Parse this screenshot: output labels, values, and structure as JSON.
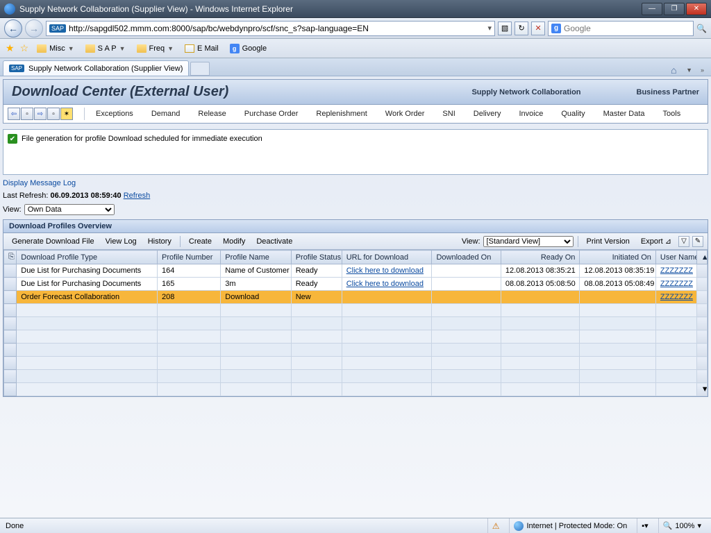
{
  "window": {
    "title": "Supply Network Collaboration (Supplier View) - Windows Internet Explorer"
  },
  "nav": {
    "url": "http://sapgdl502.mmm.com:8000/sap/bc/webdynpro/scf/snc_s?sap-language=EN",
    "search_placeholder": "Google"
  },
  "favorites": {
    "misc": "Misc",
    "sap": "S A P",
    "freq": "Freq",
    "email": "E Mail",
    "google": "Google"
  },
  "tab": {
    "label": "Supply Network Collaboration (Supplier View)"
  },
  "page": {
    "title": "Download Center (External User)",
    "header_right1": "Supply Network Collaboration",
    "header_right2": "Business Partner"
  },
  "menu": [
    "Exceptions",
    "Demand",
    "Release",
    "Purchase Order",
    "Replenishment",
    "Work Order",
    "SNI",
    "Delivery",
    "Invoice",
    "Quality",
    "Master Data",
    "Tools"
  ],
  "message": "File generation for profile Download scheduled for immediate execution",
  "display_log": "Display Message Log",
  "last_refresh_label": "Last Refresh:",
  "last_refresh_time": "06.09.2013 08:59:40",
  "refresh": "Refresh",
  "view_label": "View:",
  "view_value": "Own Data",
  "panel_title": "Download Profiles Overview",
  "toolbar": {
    "generate": "Generate Download File",
    "viewlog": "View Log",
    "history": "History",
    "create": "Create",
    "modify": "Modify",
    "deactivate": "Deactivate",
    "view_label": "View:",
    "view_value": "[Standard View]",
    "print": "Print Version",
    "export": "Export"
  },
  "columns": [
    "Download Profile Type",
    "Profile Number",
    "Profile Name",
    "Profile Status",
    "URL for Download",
    "Downloaded On",
    "Ready On",
    "Initiated On",
    "User Name"
  ],
  "rows": [
    {
      "type": "Due List for Purchasing Documents",
      "num": "164",
      "name": "Name of Customer",
      "status": "Ready",
      "url": "Click here to download",
      "dl": "",
      "ready": "12.08.2013 08:35:21",
      "init": "12.08.2013 08:35:19",
      "user": "ZZZZZZZ",
      "sel": false
    },
    {
      "type": "Due List for Purchasing Documents",
      "num": "165",
      "name": "3m",
      "status": "Ready",
      "url": "Click here to download",
      "dl": "",
      "ready": "08.08.2013 05:08:50",
      "init": "08.08.2013 05:08:49",
      "user": "ZZZZZZZ",
      "sel": false
    },
    {
      "type": "Order Forecast Collaboration",
      "num": "208",
      "name": "Download",
      "status": "New",
      "url": "",
      "dl": "",
      "ready": "",
      "init": "",
      "user": "ZZZZZZZ",
      "sel": true
    }
  ],
  "status": {
    "done": "Done",
    "zone": "Internet | Protected Mode: On",
    "zoom": "100%"
  }
}
